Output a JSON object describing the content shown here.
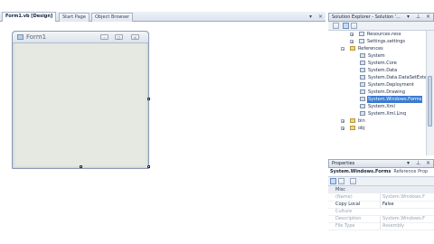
{
  "document": {
    "tabs": [
      {
        "label": "Form1.vb [Design]"
      },
      {
        "label": "Start Page"
      },
      {
        "label": "Object Browser"
      }
    ],
    "tab_controls": {
      "dropdown": "▾",
      "close": "×"
    }
  },
  "form": {
    "caption": "Form1",
    "min_glyph": "–",
    "max_glyph": "□",
    "close_glyph": "×"
  },
  "solution_explorer": {
    "title": "Solution Explorer - Solution '...",
    "header_glyphs": {
      "dropdown": "▾",
      "pin": "⊥",
      "close": "×"
    },
    "tree": [
      {
        "label": "Resources.resx",
        "icon": "resource-file-icon",
        "expander": "+"
      },
      {
        "label": "Settings.settings",
        "icon": "settings-file-icon",
        "expander": "+"
      },
      {
        "label": "References",
        "icon": "folder-icon",
        "expander": "−"
      },
      {
        "label": "System",
        "icon": "reference-icon"
      },
      {
        "label": "System.Core",
        "icon": "reference-icon"
      },
      {
        "label": "System.Data",
        "icon": "reference-icon"
      },
      {
        "label": "System.Data.DataSetExte",
        "icon": "reference-icon"
      },
      {
        "label": "System.Deployment",
        "icon": "reference-icon"
      },
      {
        "label": "System.Drawing",
        "icon": "reference-icon"
      },
      {
        "label": "System.Windows.Forms",
        "icon": "reference-icon",
        "selected": true
      },
      {
        "label": "System.Xml",
        "icon": "reference-icon"
      },
      {
        "label": "System.Xml.Linq",
        "icon": "reference-icon"
      },
      {
        "label": "bin",
        "icon": "folder-icon",
        "expander": "+"
      },
      {
        "label": "obj",
        "icon": "folder-icon",
        "expander": "+"
      }
    ]
  },
  "properties": {
    "title": "Properties",
    "header_glyphs": {
      "dropdown": "▾",
      "pin": "⊥",
      "close": "×"
    },
    "object_name": "System.Windows.Forms",
    "object_type": "Reference Prop",
    "category": "Misc",
    "rows": [
      {
        "name": "(Name)",
        "value": "System.Windows.F",
        "dim": true
      },
      {
        "name": "Copy Local",
        "value": "False",
        "dim": false
      },
      {
        "name": "Culture",
        "value": "",
        "dim": true
      },
      {
        "name": "Description",
        "value": "System.Windows.F",
        "dim": true
      },
      {
        "name": "File Type",
        "value": "Assembly",
        "dim": true
      }
    ]
  },
  "colors": {
    "selection": "#3b7bd0",
    "panel_border": "#9aa8bf",
    "form_client": "#e5e9e2"
  }
}
